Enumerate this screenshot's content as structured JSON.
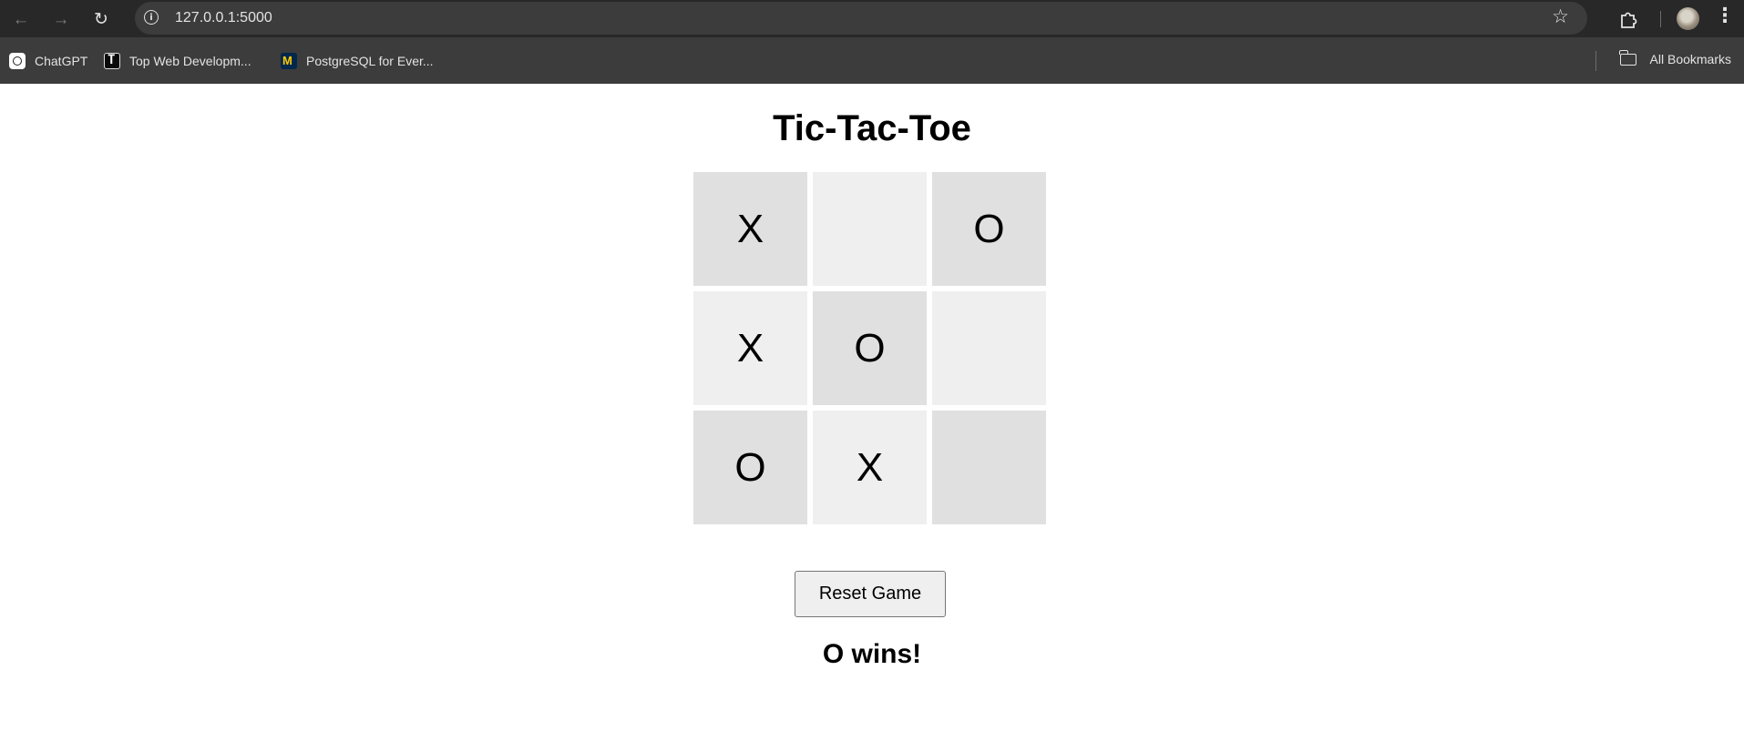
{
  "browser": {
    "url": "127.0.0.1:5000",
    "bookmarks": [
      {
        "label": "ChatGPT",
        "icon": "chatgpt-icon"
      },
      {
        "label": "Top Web Developm...",
        "icon": "top-web-dev-icon"
      },
      {
        "label": "PostgreSQL for Ever...",
        "icon": "umich-icon"
      }
    ],
    "all_bookmarks_label": "All Bookmarks"
  },
  "page": {
    "title": "Tic-Tac-Toe",
    "board": [
      {
        "mark": "X"
      },
      {
        "mark": ""
      },
      {
        "mark": "O"
      },
      {
        "mark": "X"
      },
      {
        "mark": "O"
      },
      {
        "mark": ""
      },
      {
        "mark": "O"
      },
      {
        "mark": "X"
      },
      {
        "mark": ""
      }
    ],
    "reset_label": "Reset Game",
    "status": "O wins!"
  },
  "colors": {
    "cell_dark": "#e0e0e0",
    "cell_light": "#efefef",
    "chrome_bg": "#3c3c3c",
    "topbar_bg": "#282828"
  }
}
